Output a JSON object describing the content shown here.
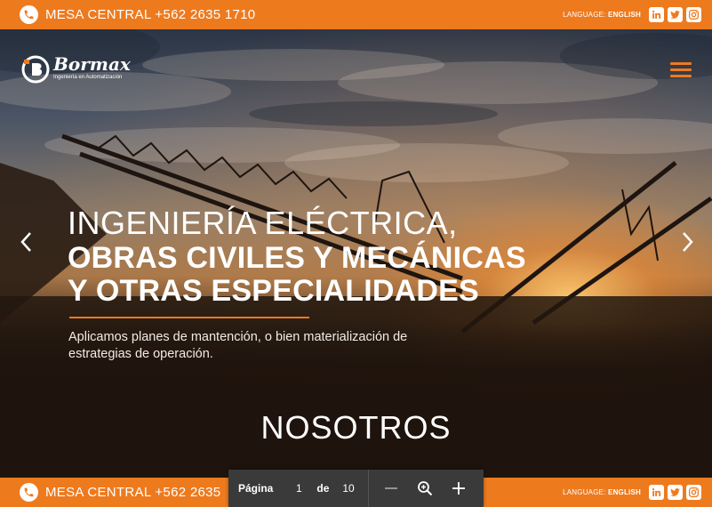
{
  "topbar": {
    "phone": "MESA CENTRAL +562 2635 1710",
    "language_label": "LANGUAGE:",
    "language_value": "ENGLISH",
    "social": [
      {
        "name": "linkedin-icon",
        "glyph": "in"
      },
      {
        "name": "twitter-icon",
        "glyph": "t"
      },
      {
        "name": "instagram-icon",
        "glyph": ""
      }
    ]
  },
  "bottombar": {
    "phone": "MESA CENTRAL +562 2635",
    "language_label": "LANGUAGE:",
    "language_value": "ENGLISH"
  },
  "logo": {
    "name": "Bormax",
    "tagline": "Ingeniería en Automatización"
  },
  "hero": {
    "line1": "INGENIERÍA ELÉCTRICA,",
    "line2": "OBRAS CIVILES Y MECÁNICAS",
    "line3": "Y OTRAS ESPECIALIDADES",
    "description": "Aplicamos planes de mantención, o bien materialización de estrategias de operación."
  },
  "section": {
    "title": "NOSOTROS"
  },
  "pdf_toolbar": {
    "page_label": "Página",
    "current_page": "1",
    "of_label": "de",
    "total_pages": "10"
  },
  "colors": {
    "accent": "#ee7a1e"
  }
}
